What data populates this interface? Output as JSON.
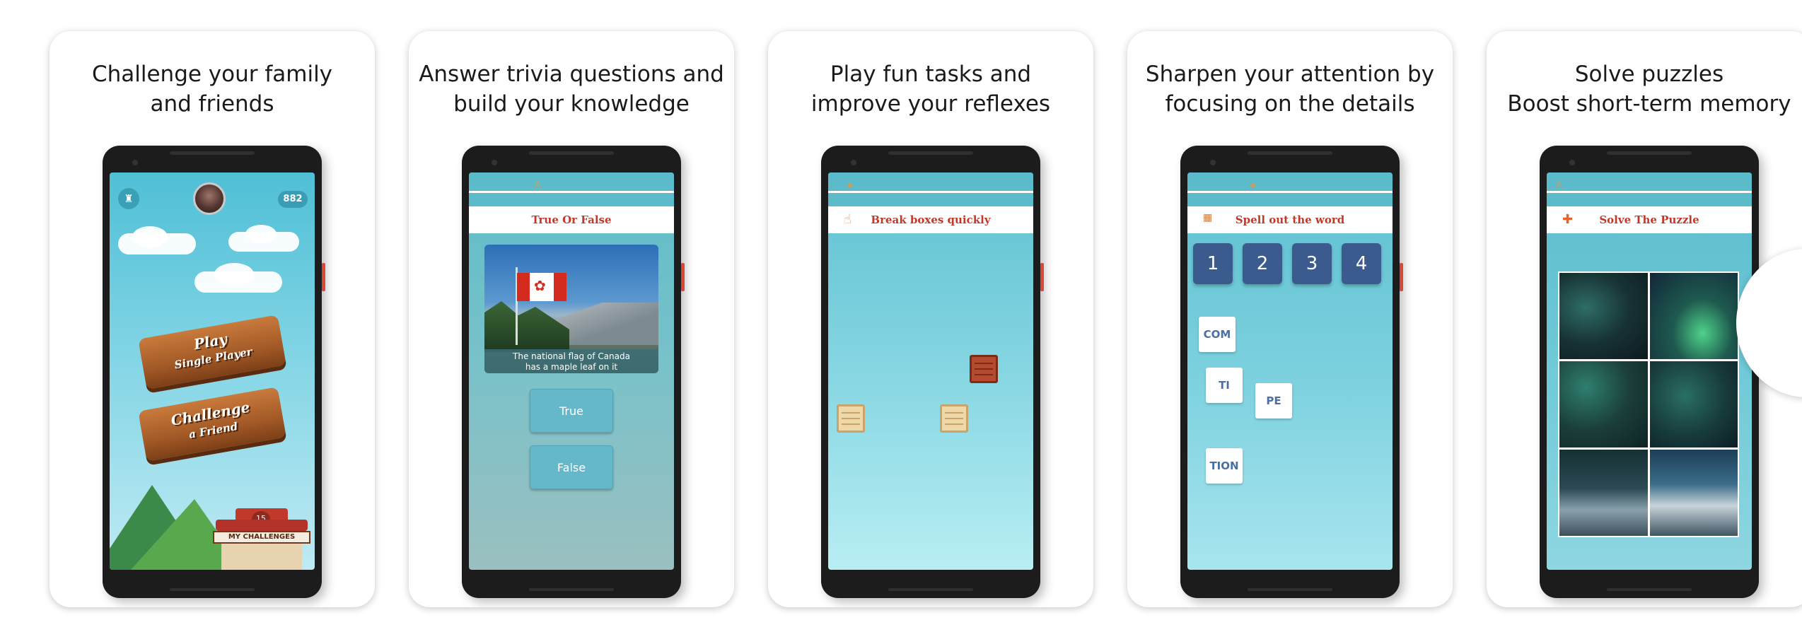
{
  "cards": [
    {
      "caption_line1": "Challenge your family",
      "caption_line2": "and friends",
      "screen": {
        "score": "882",
        "play_line1": "Play",
        "play_line2": "Single Player",
        "challenge_line1": "Challenge",
        "challenge_line2": "a Friend",
        "challenges_badge": "15",
        "challenges_label": "MY CHALLENGES"
      }
    },
    {
      "caption_line1": "Answer trivia questions and",
      "caption_line2": "build your knowledge",
      "screen": {
        "title": "True Or False",
        "question_line1": "The national flag of Canada",
        "question_line2": "has a maple leaf on it",
        "option_true": "True",
        "option_false": "False"
      }
    },
    {
      "caption_line1": "Play fun tasks and",
      "caption_line2": "improve your reflexes",
      "screen": {
        "title": "Break boxes quickly"
      }
    },
    {
      "caption_line1": "Sharpen your attention by",
      "caption_line2": "focusing on the details",
      "screen": {
        "title": "Spell out the word",
        "numbers": [
          "1",
          "2",
          "3",
          "4"
        ],
        "tiles": [
          "COM",
          "TI",
          "PE",
          "TION"
        ]
      }
    },
    {
      "caption_line1": "Solve puzzles",
      "caption_line2": "Boost short-term memory",
      "screen": {
        "title": "Solve The Puzzle"
      }
    }
  ],
  "colors": {
    "sky": "#4fbfd6",
    "title_red": "#c0392b",
    "number_box": "#3b5b8f",
    "tile_text": "#4a6fa5"
  }
}
